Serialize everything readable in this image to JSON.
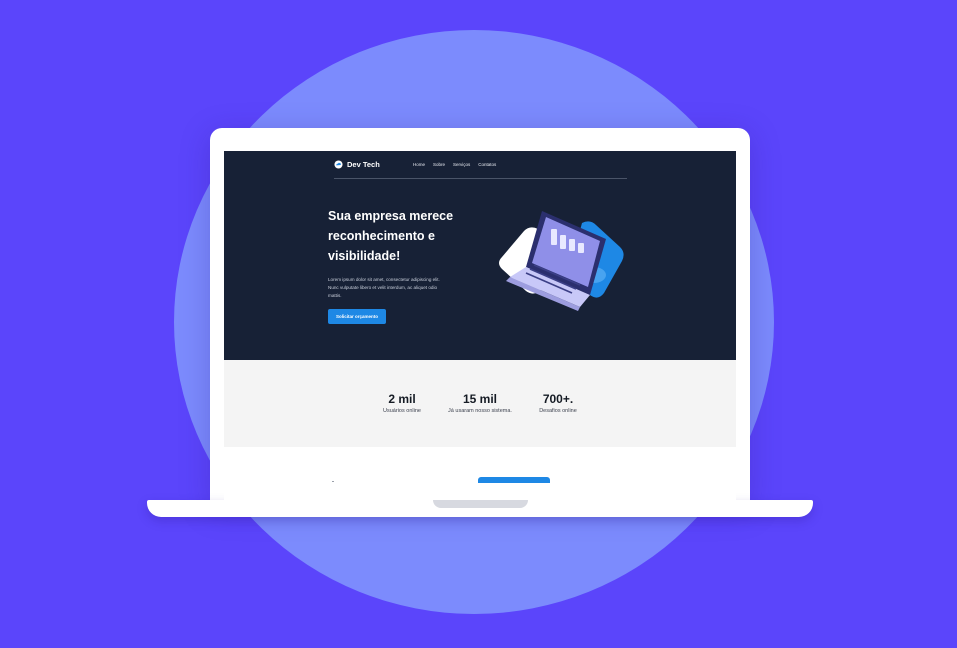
{
  "brand": {
    "name": "Dev Tech",
    "icon": "cloud-logo-icon"
  },
  "nav": {
    "items": [
      {
        "label": "Home"
      },
      {
        "label": "Sobre"
      },
      {
        "label": "Serviços"
      },
      {
        "label": "Contatos"
      }
    ]
  },
  "hero": {
    "title": "Sua empresa merece reconhecimento e visibilidade!",
    "text": "Lorem ipsum dolor sit amet, consectetur adipiscing elit. Nunc vulputate libero et velit interdum, ac aliquet odio mattis.",
    "cta_label": "Solicitar orçamento",
    "illustration": "isometric-laptop-chart-illustration"
  },
  "stats": [
    {
      "value": "2 mil",
      "label": "Usuários online"
    },
    {
      "value": "15 mil",
      "label": "Já usaram nosso sistema."
    },
    {
      "value": "700+.",
      "label": "Desafios online"
    }
  ],
  "colors": {
    "page_background": "#5b45fb",
    "circle": "#7c8bfd",
    "hero_background": "#172136",
    "accent": "#1e88e5",
    "stats_background": "#f4f4f4"
  }
}
